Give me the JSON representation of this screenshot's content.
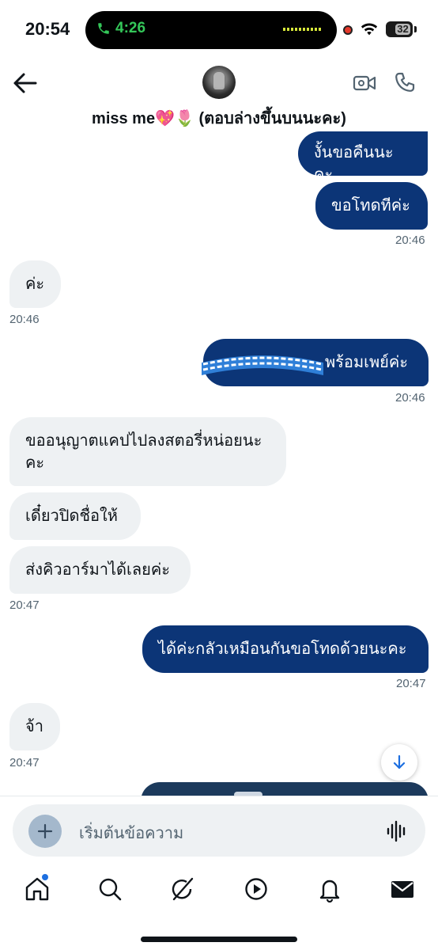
{
  "status_bar": {
    "time": "20:54",
    "call_timer": "4:26",
    "battery": "32",
    "icons": [
      "phone-icon",
      "recording-dot-icon",
      "wifi-icon",
      "battery-icon"
    ]
  },
  "header": {
    "conversation_name": "miss me💖🌷 (ตอบล่างขึ้นบนนะคะ)",
    "icons": [
      "back-arrow-icon",
      "avatar",
      "video-call-icon",
      "phone-call-icon"
    ]
  },
  "messages": [
    {
      "side": "sent",
      "text": "งั้นขอคืนนะคะ"
    },
    {
      "side": "sent",
      "text": "ขอโทดทีค่ะ"
    },
    {
      "side": "sent",
      "time": "20:46"
    },
    {
      "side": "received",
      "text": "ค่ะ"
    },
    {
      "side": "received",
      "time": "20:46"
    },
    {
      "side": "sent",
      "text": "พร้อมเพย์ค่ะ"
    },
    {
      "side": "sent",
      "time": "20:46"
    },
    {
      "side": "received",
      "text": "ขออนุญาตแคปไปลงสตอรี่หน่อยนะคะ"
    },
    {
      "side": "received",
      "text": "เดี๋ยวปิดชื่อให้"
    },
    {
      "side": "received",
      "text": "ส่งคิวอาร์มาได้เลยค่ะ"
    },
    {
      "side": "received",
      "time": "20:47"
    },
    {
      "side": "sent",
      "text": "ได้ค่ะกลัวเหมือนกันขอโทดด้วยนะคะ"
    },
    {
      "side": "sent",
      "time": "20:47"
    },
    {
      "side": "received",
      "text": "จ้า"
    },
    {
      "side": "received",
      "time": "20:47"
    }
  ],
  "composer": {
    "placeholder": "เริ่มต้นข้อความ",
    "icons": [
      "plus-icon",
      "voice-wave-icon"
    ]
  },
  "bottom_nav": {
    "items": [
      "home-icon",
      "search-icon",
      "grok-icon",
      "video-icon",
      "notifications-icon",
      "messages-icon"
    ],
    "active": "messages-icon"
  },
  "colors": {
    "sent_bubble": "#0c3577",
    "received_bubble": "#eef1f3",
    "timestamp": "#536471",
    "accent": "#1d6fe0"
  }
}
